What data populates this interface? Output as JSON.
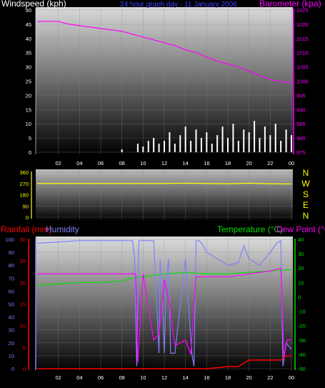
{
  "header": {
    "windspeed_label": "Windspeed (kph)",
    "period_label": "24 hour graph day - 11 January 2006",
    "barometer_label": "Barometer (kpa)"
  },
  "lower_header": {
    "rainfall_label": "Rainfall (mm)",
    "humidity_label": "Humidity",
    "temperature_label": "Temperature (°C)",
    "dewpoint_label": "Dew Point (°C)"
  },
  "colors": {
    "windspeed": "#ffffff",
    "barometer": "#ff00ff",
    "direction": "#ffff00",
    "rainfall": "#ff0000",
    "humidity": "#8080ff",
    "temperature": "#00e000",
    "dewpoint": "#ff00ff",
    "wind_gust": "#00ff00"
  },
  "chart_data": [
    {
      "name": "wind-and-pressure",
      "type": "line",
      "x_ticks": [
        "02",
        "04",
        "06",
        "08",
        "10",
        "12",
        "14",
        "16",
        "18",
        "20",
        "22",
        "00"
      ],
      "y_left": {
        "label": "Windspeed (kph)",
        "ticks": [
          0,
          5,
          10,
          15,
          20,
          25,
          30,
          35,
          40,
          45,
          50
        ],
        "range": [
          0,
          50
        ]
      },
      "y_right": {
        "label": "Barometer (kpa)",
        "ticks": [
          975,
          980,
          985,
          990,
          995,
          1000,
          1005,
          1010,
          1015,
          1020,
          1025
        ],
        "range": [
          975,
          1025
        ]
      },
      "barometer": {
        "x": [
          0,
          1,
          2,
          3,
          4,
          5,
          6,
          7,
          8,
          9,
          10,
          11,
          12,
          13,
          14,
          15,
          16,
          17,
          18,
          19,
          20,
          21,
          22,
          23,
          24
        ],
        "values": [
          1021,
          1021,
          1021,
          1020,
          1019.5,
          1019,
          1018.5,
          1018,
          1017.5,
          1016.5,
          1015.5,
          1014.5,
          1013.5,
          1012.5,
          1011,
          1010,
          1008.5,
          1007,
          1006,
          1005,
          1003.5,
          1002,
          1000.5,
          999.8,
          999.5
        ]
      },
      "windspeed_sample": {
        "x": [
          0,
          5,
          8,
          9,
          9.5,
          10,
          10.5,
          11,
          11.5,
          12,
          12.5,
          13,
          13.5,
          14,
          14.5,
          15,
          15.5,
          16,
          16.5,
          17,
          17.5,
          18,
          18.5,
          19,
          19.5,
          20,
          20.5,
          21,
          21.5,
          22,
          22.5,
          23,
          23.5,
          24
        ],
        "values": [
          0,
          0,
          1,
          0,
          3,
          2,
          4,
          5,
          3,
          4,
          7,
          3,
          6,
          9,
          4,
          8,
          5,
          7,
          3,
          6,
          9,
          5,
          10,
          4,
          8,
          7,
          11,
          5,
          9,
          6,
          10,
          4,
          8,
          6
        ]
      }
    },
    {
      "name": "wind-direction",
      "type": "line",
      "y_ticks": [
        0,
        90,
        180,
        270,
        360
      ],
      "range": [
        0,
        360
      ],
      "compass": [
        "N",
        "W",
        "S",
        "E",
        "N"
      ],
      "values_note_free": true,
      "x": [
        0,
        4,
        8,
        12,
        14,
        16,
        18,
        20,
        22,
        24
      ],
      "values": [
        270,
        270,
        270,
        270,
        272,
        270,
        268,
        272,
        268,
        266
      ]
    },
    {
      "name": "rain-humidity-temperature",
      "type": "line",
      "y_left_rain": {
        "label": "Rainfall (mm)",
        "ticks": [
          0,
          5,
          10,
          15,
          20,
          25,
          30
        ],
        "range": [
          0,
          30
        ]
      },
      "y_left_humidity": {
        "label": "Humidity",
        "ticks": [
          0,
          10,
          20,
          30,
          40,
          50,
          60,
          70,
          80,
          90,
          100
        ],
        "range": [
          0,
          100
        ]
      },
      "y_right": {
        "label": "Temperature (°C)",
        "ticks": [
          -50,
          -40,
          -30,
          -20,
          -10,
          0,
          10,
          20,
          30,
          40
        ],
        "range": [
          -50,
          40
        ]
      },
      "humidity": {
        "x": [
          0,
          2,
          4,
          6,
          8,
          8.8,
          9.0,
          9.2,
          9.4,
          9.6,
          10,
          11,
          11.5,
          11.6,
          11.8,
          12,
          12.2,
          12.4,
          12.6,
          13,
          14,
          14.6,
          14.8,
          15,
          15.3,
          15.6,
          16,
          17,
          18,
          19,
          19.5,
          20,
          21,
          22,
          22.6,
          23,
          23.2,
          23.5,
          24
        ],
        "values": [
          97,
          98,
          99,
          99,
          99,
          99,
          99,
          85,
          2,
          99,
          99,
          99,
          12,
          85,
          60,
          12,
          70,
          85,
          12,
          12,
          85,
          12,
          2,
          99,
          99,
          96,
          90,
          85,
          80,
          82,
          95,
          85,
          80,
          90,
          97,
          99,
          2,
          20,
          15
        ]
      },
      "temperature": {
        "x": [
          0,
          2,
          4,
          6,
          8,
          9,
          10,
          11,
          12,
          14,
          16,
          18,
          20,
          22,
          24
        ],
        "values": [
          8,
          9,
          10,
          10,
          11,
          13,
          14,
          15,
          16,
          17,
          16,
          16,
          17,
          18,
          19
        ]
      },
      "dewpoint": {
        "x": [
          0,
          2,
          4,
          6,
          8,
          9,
          9.3,
          9.5,
          10,
          11,
          11.5,
          12,
          12.5,
          13,
          14,
          14.5,
          15,
          16,
          18,
          20,
          22,
          23,
          23.3,
          23.6,
          24
        ],
        "values": [
          16,
          16,
          16,
          16,
          16,
          16,
          16,
          -46,
          16,
          -30,
          -26,
          12,
          -5,
          -34,
          -30,
          -40,
          14,
          14,
          14,
          16,
          18,
          20,
          -42,
          -30,
          -30
        ]
      },
      "rainfall": {
        "x": [
          0,
          14,
          16,
          18,
          19,
          20,
          22,
          23,
          23.5,
          24
        ],
        "values": [
          0,
          0,
          0,
          0.5,
          0.5,
          2,
          2,
          2,
          3,
          3
        ]
      }
    }
  ]
}
